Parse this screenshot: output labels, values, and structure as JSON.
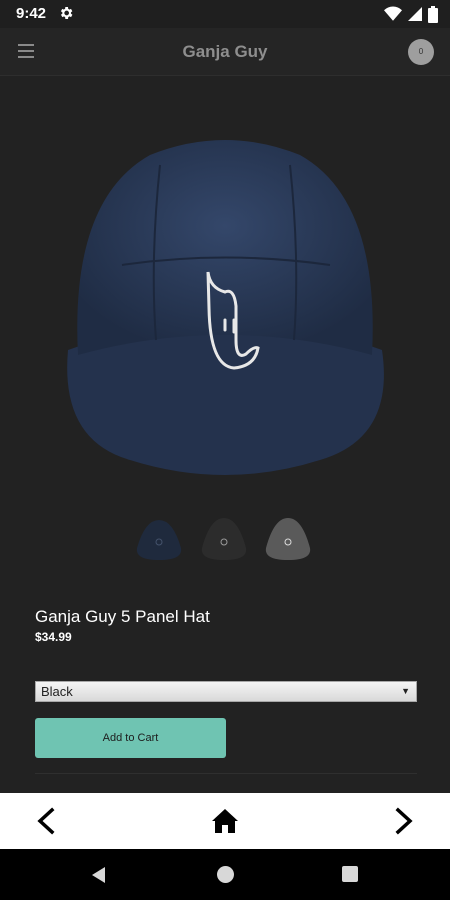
{
  "status_bar": {
    "time": "9:42",
    "icons": [
      "gear-icon",
      "wifi-icon",
      "cellular-signal-icon",
      "battery-icon"
    ]
  },
  "header": {
    "title": "Ganja Guy",
    "cart_count": "0",
    "menu_icon": "hamburger-menu-icon"
  },
  "product": {
    "title": "Ganja Guy 5 Panel Hat",
    "price": "$34.99",
    "image_color": "#2b3a57",
    "thumbnails": [
      {
        "color": "navy",
        "hex": "#1f2a3d"
      },
      {
        "color": "black",
        "hex": "#2c2c2c"
      },
      {
        "color": "charcoal",
        "hex": "#5a5a5a"
      }
    ]
  },
  "variant": {
    "selected": "Black",
    "arrow": "▼"
  },
  "actions": {
    "add_to_cart": "Add to Cart"
  },
  "bottom_nav": {
    "icons": [
      "chevron-left-icon",
      "home-icon",
      "chevron-right-icon"
    ]
  },
  "colors": {
    "background": "#222222",
    "accent": "#6fc4b2",
    "header_text": "#8e8e8e"
  }
}
